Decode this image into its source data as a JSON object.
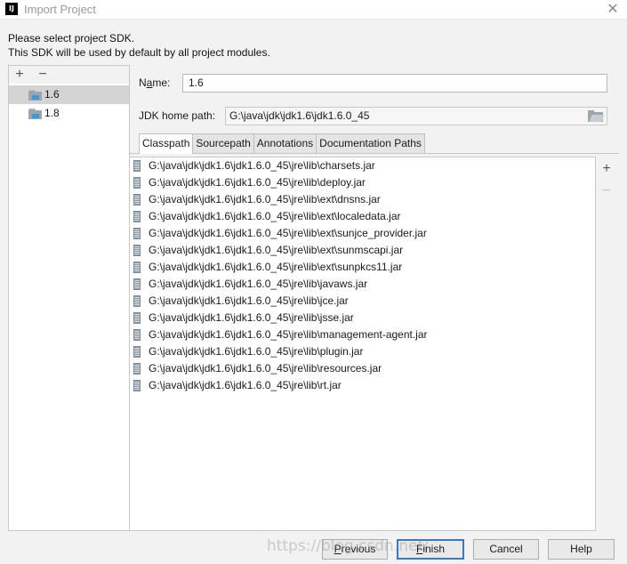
{
  "window": {
    "title": "Import Project",
    "app_icon_text": "IJ",
    "close_glyph": "✕"
  },
  "description": {
    "line1": "Please select project SDK.",
    "line2": "This SDK will be used by default by all project modules."
  },
  "sdk_panel": {
    "add_glyph": "+",
    "remove_glyph": "−",
    "items": [
      {
        "label": "1.6",
        "selected": true
      },
      {
        "label": "1.8",
        "selected": false
      }
    ]
  },
  "form": {
    "name_label_pre": "N",
    "name_label_mnemonic": "a",
    "name_label_post": "me:",
    "name_value": "1.6",
    "jdk_home_label": "JDK home path:",
    "jdk_home_value": "G:\\java\\jdk\\jdk1.6\\jdk1.6.0_45"
  },
  "tabs": [
    {
      "label": "Classpath",
      "active": true
    },
    {
      "label": "Sourcepath",
      "active": false
    },
    {
      "label": "Annotations",
      "active": false
    },
    {
      "label": "Documentation Paths",
      "active": false
    }
  ],
  "classpath": [
    "G:\\java\\jdk\\jdk1.6\\jdk1.6.0_45\\jre\\lib\\charsets.jar",
    "G:\\java\\jdk\\jdk1.6\\jdk1.6.0_45\\jre\\lib\\deploy.jar",
    "G:\\java\\jdk\\jdk1.6\\jdk1.6.0_45\\jre\\lib\\ext\\dnsns.jar",
    "G:\\java\\jdk\\jdk1.6\\jdk1.6.0_45\\jre\\lib\\ext\\localedata.jar",
    "G:\\java\\jdk\\jdk1.6\\jdk1.6.0_45\\jre\\lib\\ext\\sunjce_provider.jar",
    "G:\\java\\jdk\\jdk1.6\\jdk1.6.0_45\\jre\\lib\\ext\\sunmscapi.jar",
    "G:\\java\\jdk\\jdk1.6\\jdk1.6.0_45\\jre\\lib\\ext\\sunpkcs11.jar",
    "G:\\java\\jdk\\jdk1.6\\jdk1.6.0_45\\jre\\lib\\javaws.jar",
    "G:\\java\\jdk\\jdk1.6\\jdk1.6.0_45\\jre\\lib\\jce.jar",
    "G:\\java\\jdk\\jdk1.6\\jdk1.6.0_45\\jre\\lib\\jsse.jar",
    "G:\\java\\jdk\\jdk1.6\\jdk1.6.0_45\\jre\\lib\\management-agent.jar",
    "G:\\java\\jdk\\jdk1.6\\jdk1.6.0_45\\jre\\lib\\plugin.jar",
    "G:\\java\\jdk\\jdk1.6\\jdk1.6.0_45\\jre\\lib\\resources.jar",
    "G:\\java\\jdk\\jdk1.6\\jdk1.6.0_45\\jre\\lib\\rt.jar"
  ],
  "classpath_toolbar": {
    "add_glyph": "+",
    "remove_glyph": "−"
  },
  "buttons": {
    "previous_mnemonic": "P",
    "previous_rest": "revious",
    "finish_mnemonic": "F",
    "finish_rest": "inish",
    "cancel": "Cancel",
    "help": "Help"
  },
  "watermark": "https://blog.csdn.net/"
}
